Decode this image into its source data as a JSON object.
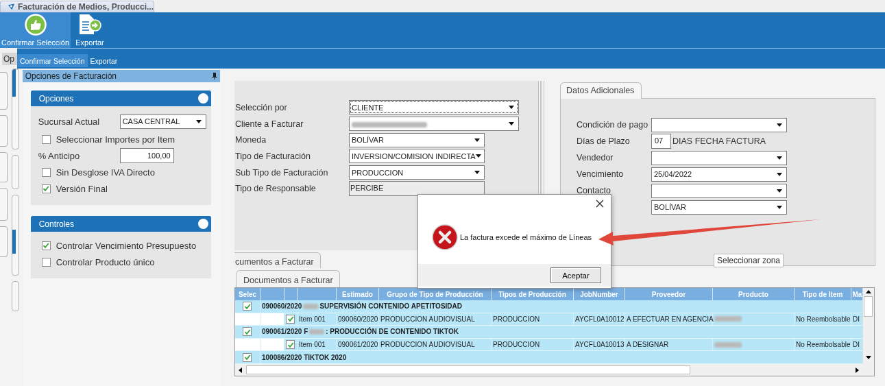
{
  "app_tab": {
    "title": "Facturación de Medios, Producci..."
  },
  "ribbon": {
    "buttons": [
      {
        "label": "Confirmar Selección",
        "selected": true
      },
      {
        "label": "Exportar",
        "selected": false
      }
    ]
  },
  "ribbon_echo": {
    "tab_fragment": "Op",
    "buttons": [
      {
        "label": "Confirmar Selección",
        "selected": true
      },
      {
        "label": "Exportar",
        "selected": false
      }
    ]
  },
  "side_panel": {
    "title": "Opciones de Facturación",
    "groups": [
      {
        "title": "Opciones",
        "items": [
          {
            "kind": "select",
            "label": "Sucursal Actual",
            "value": "CASA CENTRAL"
          },
          {
            "kind": "checkbox",
            "label": "Seleccionar Importes por Item",
            "checked": false
          },
          {
            "kind": "number",
            "label": "% Anticipo",
            "value": "100,00"
          },
          {
            "kind": "checkbox",
            "label": "Sin Desglose IVA Directo",
            "checked": false
          },
          {
            "kind": "checkbox",
            "label": "Versión Final",
            "checked": true
          }
        ]
      },
      {
        "title": "Controles",
        "items": [
          {
            "kind": "checkbox",
            "label": "Controlar Vencimiento Presupuesto",
            "checked": true
          },
          {
            "kind": "checkbox",
            "label": "Controlar Producto único",
            "checked": false
          }
        ]
      }
    ]
  },
  "selection_form": {
    "fields": [
      {
        "kind": "select_wide",
        "label": "Selección por",
        "value": "CLIENTE",
        "focused": true
      },
      {
        "kind": "select_wide",
        "label": "Cliente a Facturar",
        "redacted": true,
        "focused": false
      },
      {
        "kind": "select",
        "label": "Moneda",
        "value": "BOLÍVAR",
        "focused": false
      },
      {
        "kind": "select",
        "label": "Tipo de Facturación",
        "value": "INVERSION/COMISION INDIRECTA",
        "focused": false
      },
      {
        "kind": "select",
        "label": "Sub Tipo de Facturación",
        "value": "PRODUCCION",
        "focused": false
      },
      {
        "kind": "readonly",
        "label": "Tipo de Responsable",
        "value": "PERCIBE",
        "focused": false
      }
    ]
  },
  "additional_data": {
    "tab": {
      "label": "Datos Adicionales",
      "selected": true
    },
    "fields": [
      {
        "kind": "select",
        "label": "Condición de pago"
      },
      {
        "kind": "days",
        "label": "Días de Plazo",
        "value": "07",
        "note": "DIAS FECHA FACTURA"
      },
      {
        "kind": "select",
        "label": "Vendedor"
      },
      {
        "kind": "select",
        "label": "Vencimiento",
        "value": "25/04/2022"
      },
      {
        "kind": "select",
        "label": "Contacto"
      },
      {
        "kind": "select",
        "value": "BOLÍVAR"
      }
    ],
    "button": "Seleccionar zona"
  },
  "document_tabs": [
    {
      "label": "cumentos a Facturar",
      "selected": false
    },
    {
      "label": "Documentos a Facturar",
      "selected": true
    }
  ],
  "table": {
    "columns": [
      {
        "label": "Selec"
      },
      {},
      {},
      {},
      {
        "label": "Estimado"
      },
      {
        "label": "Grupo de Tipo de Producción"
      },
      {
        "label": "Tipos de Producción"
      },
      {
        "label": "JobNumber"
      },
      {
        "label": "Proveedor"
      },
      {
        "label": "Producto"
      },
      {
        "label": "Tipo de Item"
      },
      {
        "label": "Ma"
      }
    ],
    "rows": [
      {
        "kind": "group",
        "checked": true,
        "code": "090060/2020",
        "redacted": true,
        "title": "SUPERVISIÓN CONTENIDO APETITOSIDAD"
      },
      {
        "kind": "item",
        "checked": true,
        "cells": [
          "Item 001",
          "090060/2020",
          "PRODUCCION AUDIOVISUAL",
          "PRODUCCION",
          "AYCFL0A10012",
          "A EFECTUAR EN AGENCIA",
          null,
          "No Reembolsable",
          "DI"
        ]
      },
      {
        "kind": "group",
        "checked": true,
        "code": "090061/2020",
        "prefix": "F",
        "redacted": true,
        "title": ": PRODUCCIÓN DE CONTENIDO TIKTOK"
      },
      {
        "kind": "item",
        "checked": true,
        "cells": [
          "Item 001",
          "090061/2020",
          "PRODUCCION AUDIOVISUAL",
          "PRODUCCION",
          "AYCFL0A10013",
          "A DESIGNAR",
          null,
          "No Reembolsable",
          "DI"
        ]
      },
      {
        "kind": "group",
        "checked": true,
        "code": "100086/2020",
        "redacted": false,
        "title": "TIKTOK 2020"
      }
    ]
  },
  "dialog": {
    "message": "La factura excede el máximo de Líneas",
    "button": "Aceptar"
  }
}
